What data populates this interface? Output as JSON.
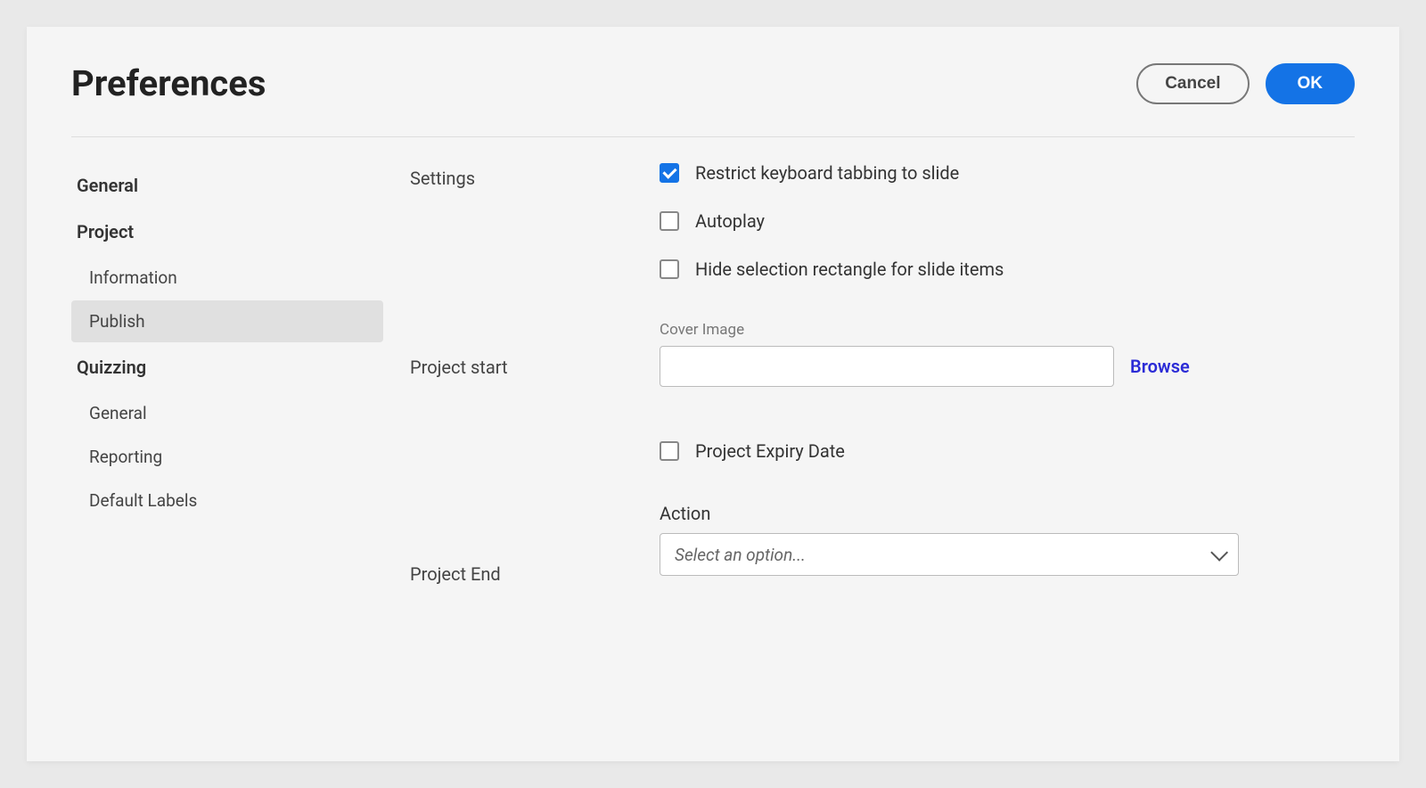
{
  "dialog": {
    "title": "Preferences",
    "cancel": "Cancel",
    "ok": "OK"
  },
  "sidebar": {
    "general": "General",
    "project": "Project",
    "project_items": [
      "Information",
      "Publish"
    ],
    "quizzing": "Quizzing",
    "quizzing_items": [
      "General",
      "Reporting",
      "Default Labels"
    ],
    "selected": "Publish"
  },
  "sections": {
    "settings": "Settings",
    "project_start": "Project start",
    "project_end": "Project End"
  },
  "settings": {
    "restrict_tab": {
      "label": "Restrict keyboard tabbing to slide",
      "checked": true
    },
    "autoplay": {
      "label": "Autoplay",
      "checked": false
    },
    "hide_selection": {
      "label": "Hide selection rectangle for slide items",
      "checked": false
    }
  },
  "project_start": {
    "cover_image_label": "Cover Image",
    "cover_image_value": "",
    "browse": "Browse",
    "expiry": {
      "label": "Project Expiry Date",
      "checked": false
    }
  },
  "project_end": {
    "action_label": "Action",
    "action_placeholder": "Select an option..."
  }
}
